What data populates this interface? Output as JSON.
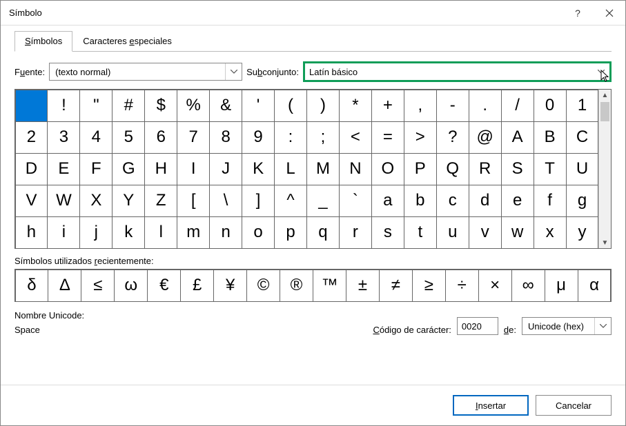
{
  "titlebar": {
    "title": "Símbolo"
  },
  "tabs": {
    "symbols": "Símbolos",
    "special": "Caracteres especiales",
    "symbols_u": "S",
    "special_u": "e"
  },
  "font": {
    "label_pre": "F",
    "label_u": "u",
    "label_post": "ente:",
    "value": "(texto normal)"
  },
  "subset": {
    "label_pre": "Su",
    "label_u": "b",
    "label_post": "conjunto:",
    "value": "Latín básico"
  },
  "grid": [
    " ",
    "!",
    "\"",
    "#",
    "$",
    "%",
    "&",
    "'",
    "(",
    ")",
    "*",
    "+",
    ",",
    "-",
    ".",
    "/",
    "0",
    "1",
    "2",
    "3",
    "4",
    "5",
    "6",
    "7",
    "8",
    "9",
    ":",
    ";",
    "<",
    "=",
    ">",
    "?",
    "@",
    "A",
    "B",
    "C",
    "D",
    "E",
    "F",
    "G",
    "H",
    "I",
    "J",
    "K",
    "L",
    "M",
    "N",
    "O",
    "P",
    "Q",
    "R",
    "S",
    "T",
    "U",
    "V",
    "W",
    "X",
    "Y",
    "Z",
    "[",
    "\\",
    "]",
    "^",
    "_",
    "`",
    "a",
    "b",
    "c",
    "d",
    "e",
    "f",
    "g",
    "h",
    "i",
    "j",
    "k",
    "l",
    "m",
    "n",
    "o",
    "p",
    "q",
    "r",
    "s",
    "t",
    "u",
    "v",
    "w",
    "x",
    "y"
  ],
  "recent": {
    "label_pre": "Símbolos utilizados ",
    "label_u": "r",
    "label_post": "ecientemente:",
    "items": [
      "δ",
      "Δ",
      "≤",
      "ω",
      "€",
      "£",
      "¥",
      "©",
      "®",
      "™",
      "±",
      "≠",
      "≥",
      "÷",
      "×",
      "∞",
      "μ",
      "α"
    ]
  },
  "unicodeName": {
    "label": "Nombre Unicode:",
    "value": "Space"
  },
  "code": {
    "label_u": "C",
    "label_post": "ódigo de carácter:",
    "value": "0020"
  },
  "from": {
    "label_u": "d",
    "label_post": "e:",
    "value": "Unicode (hex)"
  },
  "buttons": {
    "insert_u": "I",
    "insert_post": "nsertar",
    "cancel": "Cancelar"
  }
}
